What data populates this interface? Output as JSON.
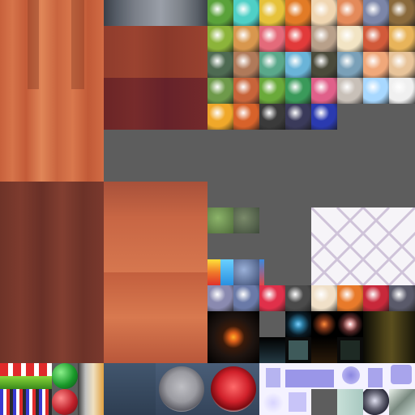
{
  "atlas": {
    "title": "",
    "background_color": "#5d5d5d",
    "sphere_colors_row1": [
      "#5aa23a",
      "#4fd0c6",
      "#e6c23a",
      "#e27b26",
      "#f0d6b2",
      "#e48a5a",
      "#7c86a8",
      "#8a6a3c"
    ],
    "sphere_colors_row2": [
      "#8cb43a",
      "#d8974e",
      "#e46a7a",
      "#e23a3a",
      "#b8a08a",
      "#f2e4c4",
      "#d25a3a",
      "#e8b45a"
    ],
    "sphere_colors_row3": [
      "#4e6a52",
      "#b07a5a",
      "#5aa88a",
      "#6ab4d8",
      "#4a4a3a",
      "#7aa0b8",
      "#f0a87a",
      "#e8c49a"
    ],
    "sphere_colors_row4": [
      "#6e9a4a",
      "#c8643a",
      "#6aaa3a",
      "#3a9a5a",
      "#e0608a",
      "#c8c0b8",
      "#a8d8ff",
      "#f0f0f0"
    ],
    "sphere_colors_row5": [
      "#f0a82a",
      "#d8622a",
      "#3a3a3a",
      "#3a3a5a",
      "#2a3ab0"
    ],
    "sphere_colors_row6": [
      "#8a8ab0",
      "#6a7aa8",
      "#e0304a",
      "#4a4a4a",
      "#f0e0c8",
      "#e87a2a",
      "#c8283a",
      "#5a5a6a"
    ],
    "buttons": {
      "grey_button_color": "#9a9aa0",
      "red_button_color": "#d0202a"
    }
  }
}
